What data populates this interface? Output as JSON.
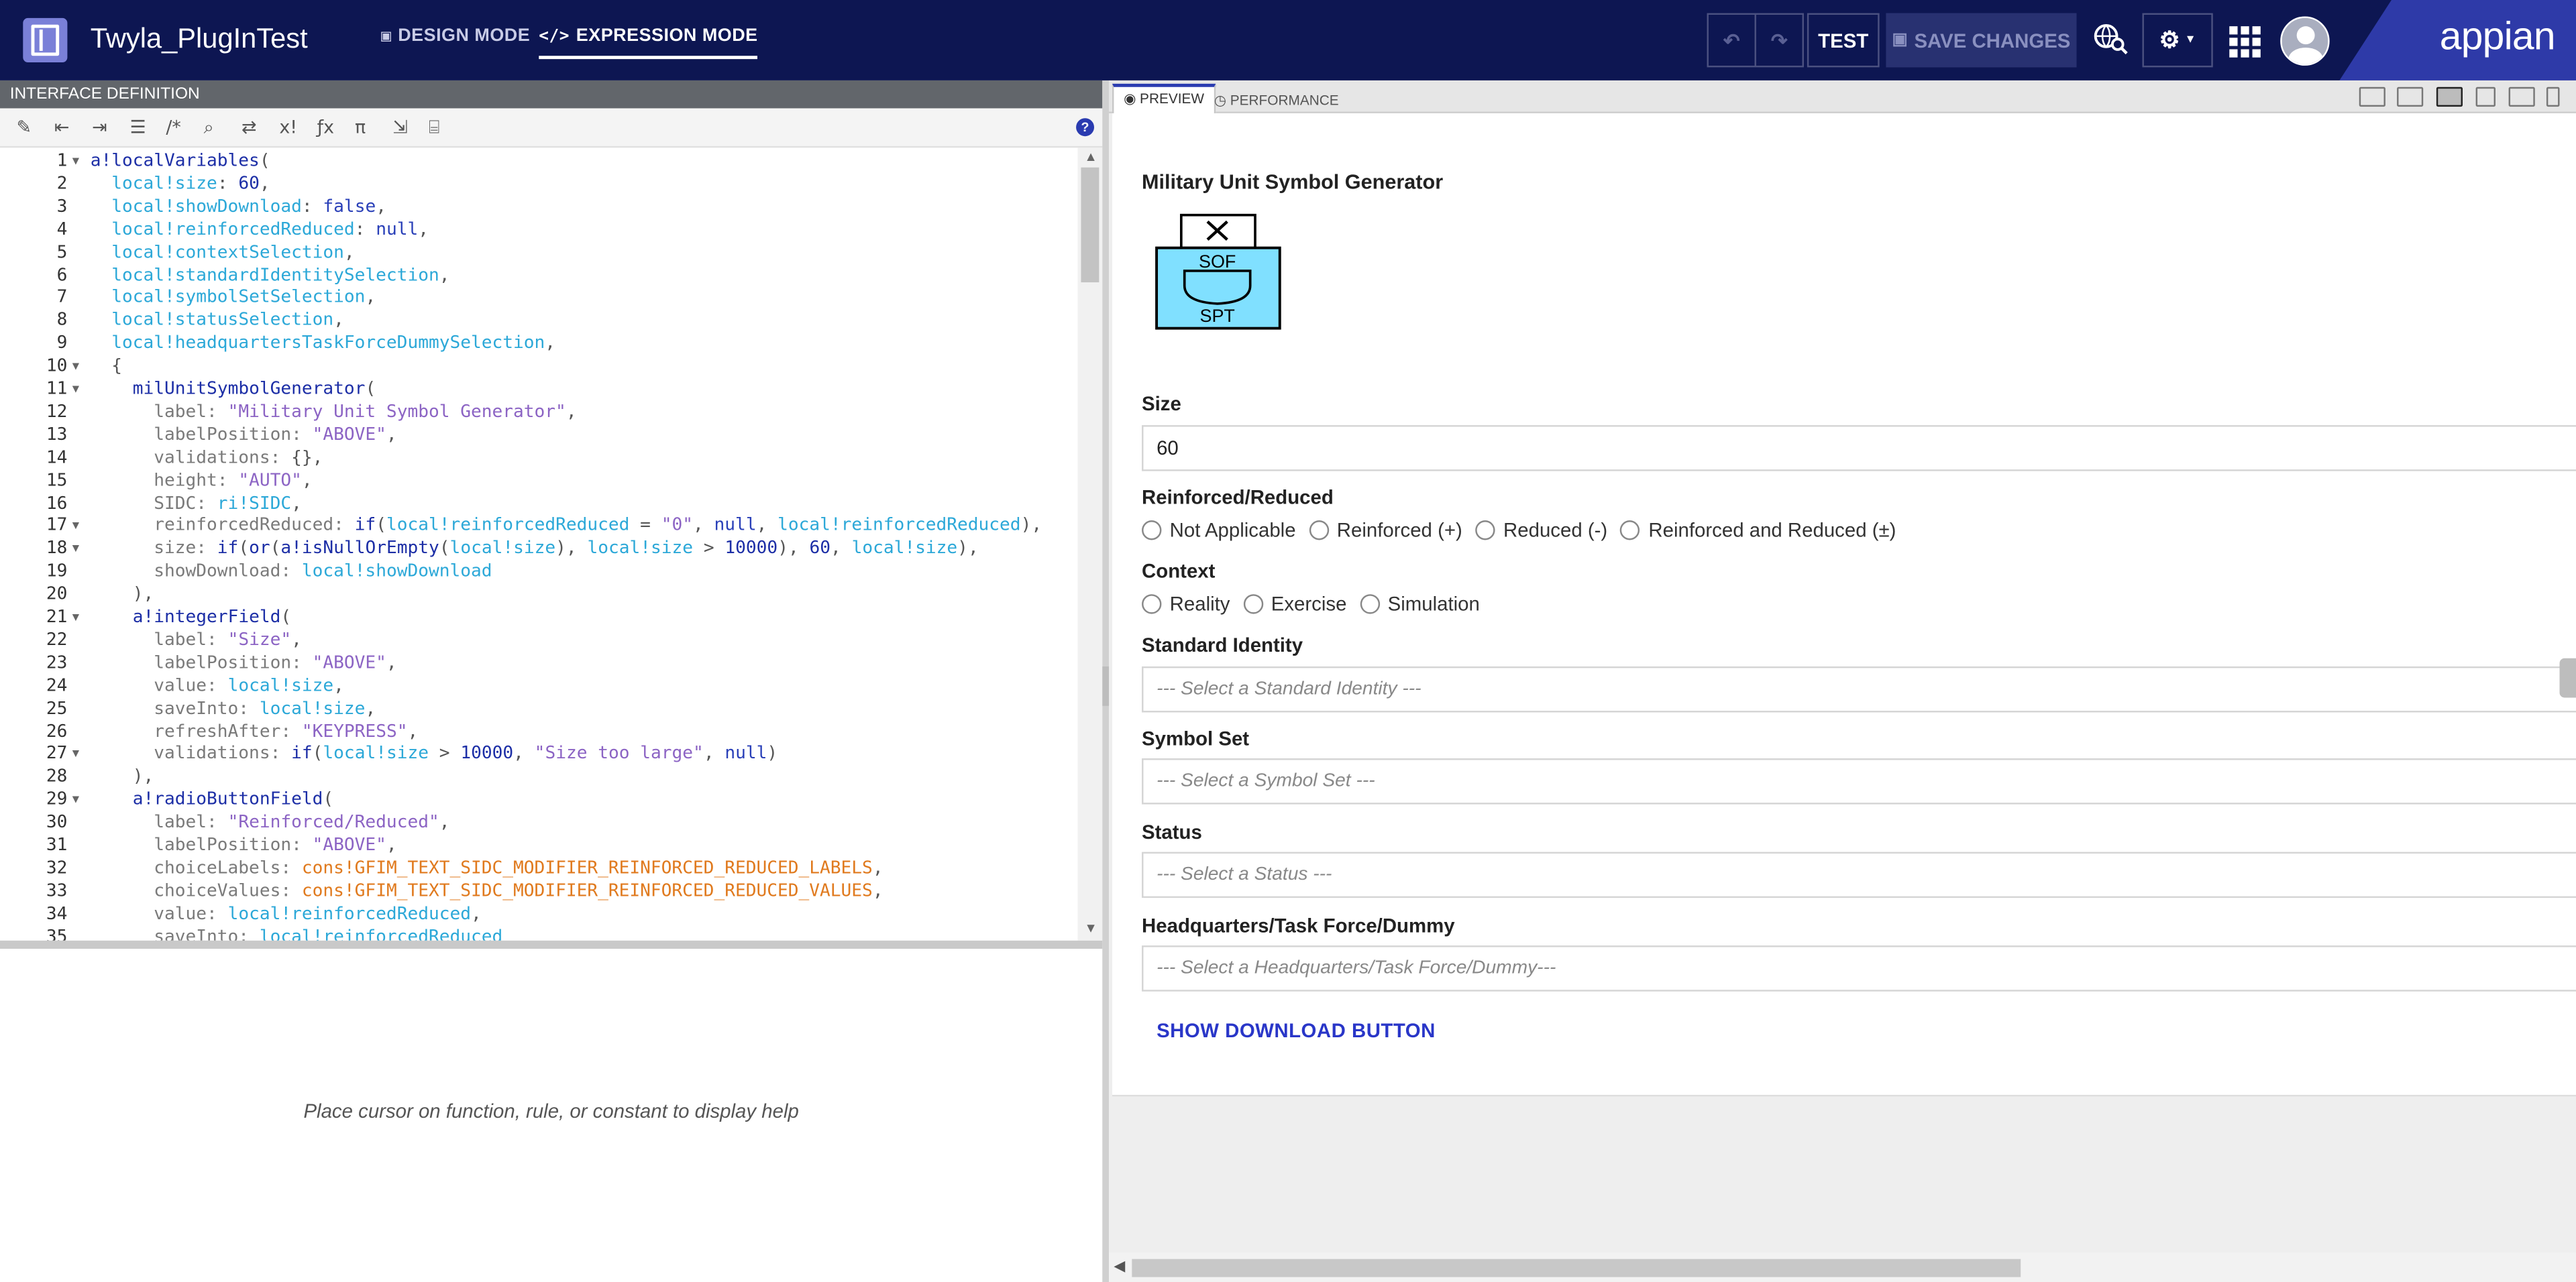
{
  "header": {
    "app_title": "Twyla_PlugInTest",
    "design_mode": "DESIGN MODE",
    "expression_mode": "EXPRESSION MODE",
    "test_label": "TEST",
    "save_label": "SAVE CHANGES",
    "brand": "appian"
  },
  "editor": {
    "panel_title": "INTERFACE DEFINITION",
    "help_placeholder": "Place cursor on function, rule, or constant to display help",
    "lines": [
      {
        "n": "1",
        "fold": true,
        "tokens": [
          {
            "c": "t-fn",
            "t": "a!localVariables"
          },
          {
            "c": "t-plain",
            "t": "("
          }
        ]
      },
      {
        "n": "2",
        "fold": false,
        "tokens": [
          {
            "c": "",
            "t": "  "
          },
          {
            "c": "t-var",
            "t": "local!size"
          },
          {
            "c": "t-plain",
            "t": ": "
          },
          {
            "c": "t-num",
            "t": "60"
          },
          {
            "c": "t-plain",
            "t": ","
          }
        ]
      },
      {
        "n": "3",
        "fold": false,
        "tokens": [
          {
            "c": "",
            "t": "  "
          },
          {
            "c": "t-var",
            "t": "local!showDownload"
          },
          {
            "c": "t-plain",
            "t": ": "
          },
          {
            "c": "t-kw",
            "t": "false"
          },
          {
            "c": "t-plain",
            "t": ","
          }
        ]
      },
      {
        "n": "4",
        "fold": false,
        "tokens": [
          {
            "c": "",
            "t": "  "
          },
          {
            "c": "t-var",
            "t": "local!reinforcedReduced"
          },
          {
            "c": "t-plain",
            "t": ": "
          },
          {
            "c": "t-kw",
            "t": "null"
          },
          {
            "c": "t-plain",
            "t": ","
          }
        ]
      },
      {
        "n": "5",
        "fold": false,
        "tokens": [
          {
            "c": "",
            "t": "  "
          },
          {
            "c": "t-var",
            "t": "local!contextSelection"
          },
          {
            "c": "t-plain",
            "t": ","
          }
        ]
      },
      {
        "n": "6",
        "fold": false,
        "tokens": [
          {
            "c": "",
            "t": "  "
          },
          {
            "c": "t-var",
            "t": "local!standardIdentitySelection"
          },
          {
            "c": "t-plain",
            "t": ","
          }
        ]
      },
      {
        "n": "7",
        "fold": false,
        "tokens": [
          {
            "c": "",
            "t": "  "
          },
          {
            "c": "t-var",
            "t": "local!symbolSetSelection"
          },
          {
            "c": "t-plain",
            "t": ","
          }
        ]
      },
      {
        "n": "8",
        "fold": false,
        "tokens": [
          {
            "c": "",
            "t": "  "
          },
          {
            "c": "t-var",
            "t": "local!statusSelection"
          },
          {
            "c": "t-plain",
            "t": ","
          }
        ]
      },
      {
        "n": "9",
        "fold": false,
        "tokens": [
          {
            "c": "",
            "t": "  "
          },
          {
            "c": "t-var",
            "t": "local!headquartersTaskForceDummySelection"
          },
          {
            "c": "t-plain",
            "t": ","
          }
        ]
      },
      {
        "n": "10",
        "fold": true,
        "tokens": [
          {
            "c": "",
            "t": "  "
          },
          {
            "c": "t-plain",
            "t": "{"
          }
        ]
      },
      {
        "n": "11",
        "fold": true,
        "tokens": [
          {
            "c": "",
            "t": "    "
          },
          {
            "c": "t-fn",
            "t": "milUnitSymbolGenerator"
          },
          {
            "c": "t-plain",
            "t": "("
          }
        ]
      },
      {
        "n": "12",
        "fold": false,
        "tokens": [
          {
            "c": "",
            "t": "      label: "
          },
          {
            "c": "t-str",
            "t": "\"Military Unit Symbol Generator\""
          },
          {
            "c": "t-plain",
            "t": ","
          }
        ]
      },
      {
        "n": "13",
        "fold": false,
        "tokens": [
          {
            "c": "",
            "t": "      labelPosition: "
          },
          {
            "c": "t-str",
            "t": "\"ABOVE\""
          },
          {
            "c": "t-plain",
            "t": ","
          }
        ]
      },
      {
        "n": "14",
        "fold": false,
        "tokens": [
          {
            "c": "",
            "t": "      validations: "
          },
          {
            "c": "t-plain",
            "t": "{},"
          }
        ]
      },
      {
        "n": "15",
        "fold": false,
        "tokens": [
          {
            "c": "",
            "t": "      height: "
          },
          {
            "c": "t-str",
            "t": "\"AUTO\""
          },
          {
            "c": "t-plain",
            "t": ","
          }
        ]
      },
      {
        "n": "16",
        "fold": false,
        "tokens": [
          {
            "c": "",
            "t": "      SIDC: "
          },
          {
            "c": "t-var",
            "t": "ri!SIDC"
          },
          {
            "c": "t-plain",
            "t": ","
          }
        ]
      },
      {
        "n": "17",
        "fold": true,
        "tokens": [
          {
            "c": "",
            "t": "      reinforcedReduced: "
          },
          {
            "c": "t-fn",
            "t": "if"
          },
          {
            "c": "t-plain",
            "t": "("
          },
          {
            "c": "t-var",
            "t": "local!reinforcedReduced"
          },
          {
            "c": "t-plain",
            "t": " = "
          },
          {
            "c": "t-str",
            "t": "\"0\""
          },
          {
            "c": "t-plain",
            "t": ", "
          },
          {
            "c": "t-kw",
            "t": "null"
          },
          {
            "c": "t-plain",
            "t": ", "
          },
          {
            "c": "t-var",
            "t": "local!reinforcedReduced"
          },
          {
            "c": "t-plain",
            "t": "),"
          }
        ]
      },
      {
        "n": "18",
        "fold": true,
        "tokens": [
          {
            "c": "",
            "t": "      size: "
          },
          {
            "c": "t-fn",
            "t": "if"
          },
          {
            "c": "t-plain",
            "t": "("
          },
          {
            "c": "t-fn",
            "t": "or"
          },
          {
            "c": "t-plain",
            "t": "("
          },
          {
            "c": "t-fn",
            "t": "a!isNullOrEmpty"
          },
          {
            "c": "t-plain",
            "t": "("
          },
          {
            "c": "t-var",
            "t": "local!size"
          },
          {
            "c": "t-plain",
            "t": "), "
          },
          {
            "c": "t-var",
            "t": "local!size"
          },
          {
            "c": "t-plain",
            "t": " > "
          },
          {
            "c": "t-num",
            "t": "10000"
          },
          {
            "c": "t-plain",
            "t": "), "
          },
          {
            "c": "t-num",
            "t": "60"
          },
          {
            "c": "t-plain",
            "t": ", "
          },
          {
            "c": "t-var",
            "t": "local!size"
          },
          {
            "c": "t-plain",
            "t": "),"
          }
        ]
      },
      {
        "n": "19",
        "fold": false,
        "tokens": [
          {
            "c": "",
            "t": "      showDownload: "
          },
          {
            "c": "t-var",
            "t": "local!showDownload"
          }
        ]
      },
      {
        "n": "20",
        "fold": false,
        "tokens": [
          {
            "c": "",
            "t": "    "
          },
          {
            "c": "t-plain",
            "t": "),"
          }
        ]
      },
      {
        "n": "21",
        "fold": true,
        "tokens": [
          {
            "c": "",
            "t": "    "
          },
          {
            "c": "t-fn",
            "t": "a!integerField"
          },
          {
            "c": "t-plain",
            "t": "("
          }
        ]
      },
      {
        "n": "22",
        "fold": false,
        "tokens": [
          {
            "c": "",
            "t": "      label: "
          },
          {
            "c": "t-str",
            "t": "\"Size\""
          },
          {
            "c": "t-plain",
            "t": ","
          }
        ]
      },
      {
        "n": "23",
        "fold": false,
        "tokens": [
          {
            "c": "",
            "t": "      labelPosition: "
          },
          {
            "c": "t-str",
            "t": "\"ABOVE\""
          },
          {
            "c": "t-plain",
            "t": ","
          }
        ]
      },
      {
        "n": "24",
        "fold": false,
        "tokens": [
          {
            "c": "",
            "t": "      value: "
          },
          {
            "c": "t-var",
            "t": "local!size"
          },
          {
            "c": "t-plain",
            "t": ","
          }
        ]
      },
      {
        "n": "25",
        "fold": false,
        "tokens": [
          {
            "c": "",
            "t": "      saveInto: "
          },
          {
            "c": "t-var",
            "t": "local!size"
          },
          {
            "c": "t-plain",
            "t": ","
          }
        ]
      },
      {
        "n": "26",
        "fold": false,
        "tokens": [
          {
            "c": "",
            "t": "      refreshAfter: "
          },
          {
            "c": "t-str",
            "t": "\"KEYPRESS\""
          },
          {
            "c": "t-plain",
            "t": ","
          }
        ]
      },
      {
        "n": "27",
        "fold": true,
        "tokens": [
          {
            "c": "",
            "t": "      validations: "
          },
          {
            "c": "t-fn",
            "t": "if"
          },
          {
            "c": "t-plain",
            "t": "("
          },
          {
            "c": "t-var",
            "t": "local!size"
          },
          {
            "c": "t-plain",
            "t": " > "
          },
          {
            "c": "t-num",
            "t": "10000"
          },
          {
            "c": "t-plain",
            "t": ", "
          },
          {
            "c": "t-str",
            "t": "\"Size too large\""
          },
          {
            "c": "t-plain",
            "t": ", "
          },
          {
            "c": "t-kw",
            "t": "null"
          },
          {
            "c": "t-plain",
            "t": ")"
          }
        ]
      },
      {
        "n": "28",
        "fold": false,
        "tokens": [
          {
            "c": "",
            "t": "    "
          },
          {
            "c": "t-plain",
            "t": "),"
          }
        ]
      },
      {
        "n": "29",
        "fold": true,
        "tokens": [
          {
            "c": "",
            "t": "    "
          },
          {
            "c": "t-fn",
            "t": "a!radioButtonField"
          },
          {
            "c": "t-plain",
            "t": "("
          }
        ]
      },
      {
        "n": "30",
        "fold": false,
        "tokens": [
          {
            "c": "",
            "t": "      label: "
          },
          {
            "c": "t-str",
            "t": "\"Reinforced/Reduced\""
          },
          {
            "c": "t-plain",
            "t": ","
          }
        ]
      },
      {
        "n": "31",
        "fold": false,
        "tokens": [
          {
            "c": "",
            "t": "      labelPosition: "
          },
          {
            "c": "t-str",
            "t": "\"ABOVE\""
          },
          {
            "c": "t-plain",
            "t": ","
          }
        ]
      },
      {
        "n": "32",
        "fold": false,
        "tokens": [
          {
            "c": "",
            "t": "      choiceLabels: "
          },
          {
            "c": "t-cons",
            "t": "cons!GFIM_TEXT_SIDC_MODIFIER_REINFORCED_REDUCED_LABELS"
          },
          {
            "c": "t-plain",
            "t": ","
          }
        ]
      },
      {
        "n": "33",
        "fold": false,
        "tokens": [
          {
            "c": "",
            "t": "      choiceValues: "
          },
          {
            "c": "t-cons",
            "t": "cons!GFIM_TEXT_SIDC_MODIFIER_REINFORCED_REDUCED_VALUES"
          },
          {
            "c": "t-plain",
            "t": ","
          }
        ]
      },
      {
        "n": "34",
        "fold": false,
        "tokens": [
          {
            "c": "",
            "t": "      value: "
          },
          {
            "c": "t-var",
            "t": "local!reinforcedReduced"
          },
          {
            "c": "t-plain",
            "t": ","
          }
        ]
      },
      {
        "n": "35",
        "fold": false,
        "tokens": [
          {
            "c": "",
            "t": "      saveInto: "
          },
          {
            "c": "t-var",
            "t": "local!reinforcedReduced"
          }
        ]
      }
    ]
  },
  "preview": {
    "tab_preview": "PREVIEW",
    "tab_performance": "PERFORMANCE",
    "title": "Military Unit Symbol Generator",
    "symbol_top_text": "SOF",
    "symbol_bottom_text": "SPT",
    "size_label": "Size",
    "size_value": "60",
    "reinforced_label": "Reinforced/Reduced",
    "reinforced_options": [
      "Not Applicable",
      "Reinforced (+)",
      "Reduced (-)",
      "Reinforced and Reduced (±)"
    ],
    "context_label": "Context",
    "context_options": [
      "Reality",
      "Exercise",
      "Simulation"
    ],
    "standard_identity_label": "Standard Identity",
    "standard_identity_placeholder": "--- Select a Standard Identity ---",
    "symbol_set_label": "Symbol Set",
    "symbol_set_placeholder": "--- Select a Symbol Set ---",
    "status_label": "Status",
    "status_placeholder": "--- Select a Status ---",
    "hq_label": "Headquarters/Task Force/Dummy",
    "hq_placeholder": "--- Select a Headquarters/Task Force/Dummy---",
    "download_button": "SHOW DOWNLOAD BUTTON"
  },
  "colors": {
    "header_bg": "#0d1652",
    "brand_bg": "#2e3aa8",
    "symbol_fill": "#80e0ff",
    "link": "#2936c8"
  }
}
